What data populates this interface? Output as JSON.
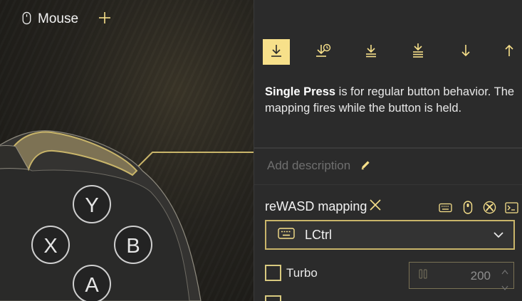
{
  "header": {
    "tab_label": "Mouse",
    "tab_icon": "mouse-icon",
    "add_icon": "plus-icon"
  },
  "controller": {
    "buttons": [
      {
        "label": "Y"
      },
      {
        "label": "X"
      },
      {
        "label": "B"
      },
      {
        "label": "A"
      }
    ]
  },
  "panel": {
    "press_types": [
      {
        "name": "single-press-icon",
        "active": true
      },
      {
        "name": "long-press-icon",
        "active": false
      },
      {
        "name": "double-press-icon",
        "active": false
      },
      {
        "name": "triple-press-icon",
        "active": false
      },
      {
        "name": "start-press-icon",
        "active": false
      },
      {
        "name": "release-icon",
        "active": false
      }
    ],
    "description_bold": "Single Press",
    "description_rest": " is for regular button behavior. The mapping fires while the button is held.",
    "add_description": "Add description",
    "mapping_title": "reWASD mapping",
    "mapping_icons": [
      "keyboard-icon",
      "mouse-icon",
      "xbox-icon",
      "terminal-icon"
    ],
    "selected_key": "LCtrl",
    "turbo_label": "Turbo",
    "turbo_value": "200"
  },
  "colors": {
    "accent": "#f7e08a",
    "panel_bg": "#2b2b2b",
    "border_accent": "#c9b56a"
  }
}
